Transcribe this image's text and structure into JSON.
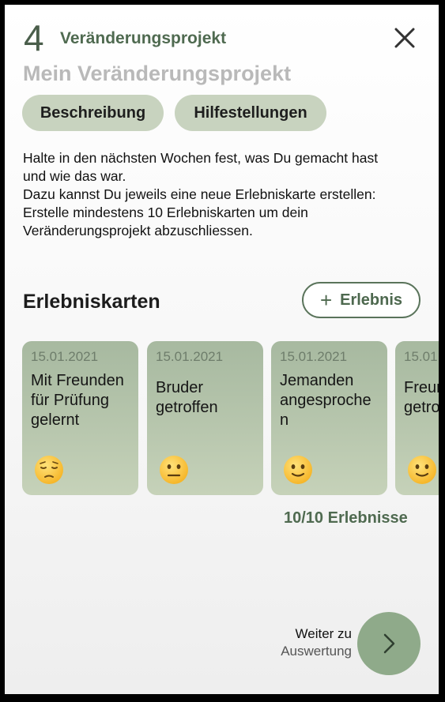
{
  "header": {
    "step_number": "4",
    "step_title": "Veränderungsprojekt",
    "page_title": "Mein Veränderungsprojekt"
  },
  "tabs": {
    "description": "Beschreibung",
    "help": "Hilfestellungen"
  },
  "intro": {
    "lines": [
      "Halte in den nächsten Wochen fest, was Du gemacht hast",
      "und wie das war.",
      "Dazu kannst Du jeweils eine neue Erlebniskarte erstellen:",
      "Erstelle mindestens 10 Erlebniskarten um dein",
      "Veränderungsprojekt abzuschliessen."
    ]
  },
  "section": {
    "title": "Erlebniskarten",
    "add_plus": "+",
    "add_label": "Erlebnis"
  },
  "cards": [
    {
      "date": "15.01.2021",
      "lines": [
        "Mit Freunden",
        "für Prüfung",
        "gelernt"
      ],
      "emoji": "pensive-face-icon"
    },
    {
      "date": "15.01.2021",
      "lines": [
        "Bruder",
        "getroffen"
      ],
      "emoji": "neutral-face-icon"
    },
    {
      "date": "15.01.2021",
      "lines": [
        "Jemanden",
        "angesproche",
        "n"
      ],
      "emoji": "slightly-smiling-face-icon"
    },
    {
      "date": "15.01",
      "lines": [
        "Freun",
        "getro"
      ],
      "emoji": "slightly-smiling-face-icon"
    }
  ],
  "progress": {
    "count_text": "10/10 Erlebnisse"
  },
  "footer": {
    "next_line1": "Weiter zu",
    "next_line2": "Auswertung"
  },
  "colors": {
    "accent": "#4f6a50",
    "pill_bg": "#c8d3bf",
    "card_bg": "#b5c4ab",
    "fab_bg": "#8faa8a"
  }
}
